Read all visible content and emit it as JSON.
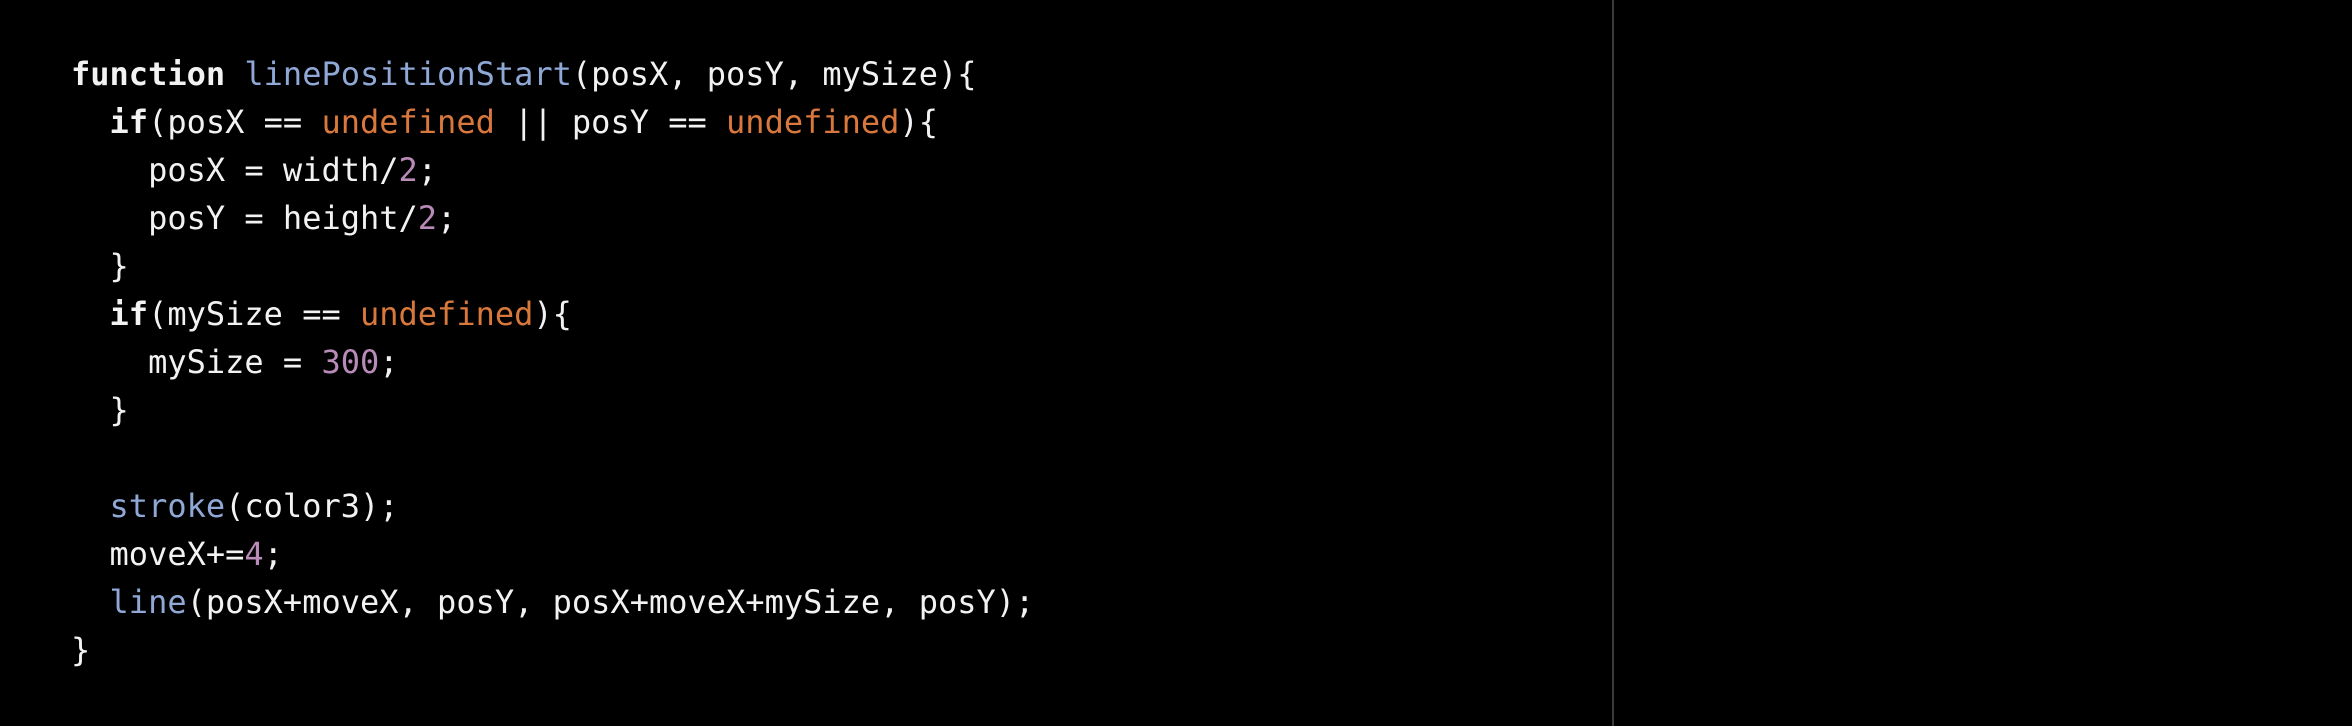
{
  "colors": {
    "background": "#000000",
    "text": "#f2f2f2",
    "function_name": "#8fa8d6",
    "constant": "#d9783c",
    "number": "#b98bb8",
    "divider": "#3b3b3b"
  },
  "editor": {
    "lines": [
      [
        {
          "t": "function",
          "c": "kw"
        },
        {
          "t": " ",
          "c": ""
        },
        {
          "t": "linePositionStart",
          "c": "fn"
        },
        {
          "t": "(posX, posY, mySize){",
          "c": ""
        }
      ],
      [
        {
          "t": "  ",
          "c": ""
        },
        {
          "t": "if",
          "c": "kw"
        },
        {
          "t": "(posX == ",
          "c": ""
        },
        {
          "t": "undefined",
          "c": "const"
        },
        {
          "t": " || posY == ",
          "c": ""
        },
        {
          "t": "undefined",
          "c": "const"
        },
        {
          "t": "){",
          "c": ""
        }
      ],
      [
        {
          "t": "    posX = width/",
          "c": ""
        },
        {
          "t": "2",
          "c": "num"
        },
        {
          "t": ";",
          "c": ""
        }
      ],
      [
        {
          "t": "    posY = height/",
          "c": ""
        },
        {
          "t": "2",
          "c": "num"
        },
        {
          "t": ";",
          "c": ""
        }
      ],
      [
        {
          "t": "  }",
          "c": ""
        }
      ],
      [
        {
          "t": "  ",
          "c": ""
        },
        {
          "t": "if",
          "c": "kw"
        },
        {
          "t": "(mySize == ",
          "c": ""
        },
        {
          "t": "undefined",
          "c": "const"
        },
        {
          "t": "){",
          "c": ""
        }
      ],
      [
        {
          "t": "    mySize = ",
          "c": ""
        },
        {
          "t": "300",
          "c": "num"
        },
        {
          "t": ";",
          "c": ""
        }
      ],
      [
        {
          "t": "  }",
          "c": ""
        }
      ],
      [],
      [
        {
          "t": "  ",
          "c": ""
        },
        {
          "t": "stroke",
          "c": "fn"
        },
        {
          "t": "(color3);",
          "c": ""
        }
      ],
      [
        {
          "t": "  moveX+=",
          "c": ""
        },
        {
          "t": "4",
          "c": "num"
        },
        {
          "t": ";",
          "c": ""
        }
      ],
      [
        {
          "t": "  ",
          "c": ""
        },
        {
          "t": "line",
          "c": "fn"
        },
        {
          "t": "(posX+moveX, posY, posX+moveX+mySize, posY);",
          "c": ""
        }
      ],
      [
        {
          "t": "}",
          "c": ""
        }
      ]
    ]
  }
}
